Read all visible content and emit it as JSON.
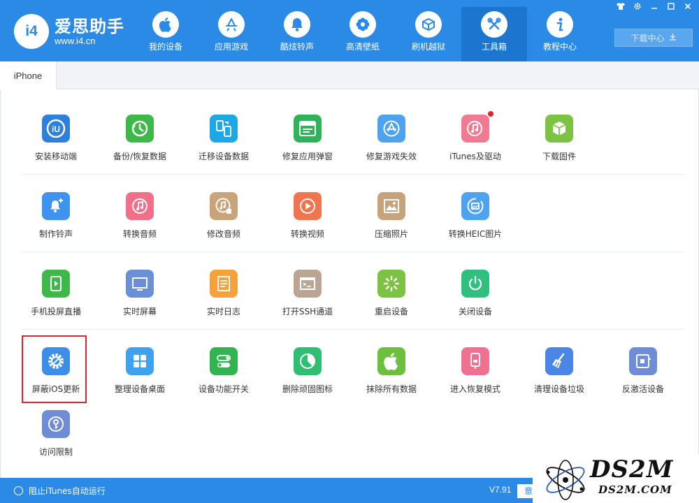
{
  "app": {
    "brand": "爱思助手",
    "url": "www.i4.cn",
    "logo_mark": "i4",
    "window_controls": [
      "shirt-icon",
      "gear-icon",
      "minimize-icon",
      "maximize-icon",
      "close-icon"
    ]
  },
  "nav": {
    "items": [
      {
        "label": "我的设备",
        "icon": "apple-icon"
      },
      {
        "label": "应用游戏",
        "icon": "app-store-icon"
      },
      {
        "label": "酷炫铃声",
        "icon": "bell-icon"
      },
      {
        "label": "高清壁纸",
        "icon": "flower-icon"
      },
      {
        "label": "刷机越狱",
        "icon": "box-icon"
      },
      {
        "label": "工具箱",
        "icon": "tools-icon",
        "active": true
      },
      {
        "label": "教程中心",
        "icon": "info-icon"
      }
    ],
    "download_label": "下载中心"
  },
  "tabs": [
    {
      "label": "iPhone",
      "active": true
    }
  ],
  "tools": {
    "row1": [
      {
        "label": "安装移动端",
        "color": "#2f7fdc"
      },
      {
        "label": "备份/恢复数据",
        "color": "#3fb84a"
      },
      {
        "label": "迁移设备数据",
        "color": "#1ca7e6"
      },
      {
        "label": "修复应用弹窗",
        "color": "#2fb35a"
      },
      {
        "label": "修复游戏失效",
        "color": "#4ea2ee"
      },
      {
        "label": "iTunes及驱动",
        "color": "#f07a92",
        "badge": true
      },
      {
        "label": "下载固件",
        "color": "#7cc243"
      }
    ],
    "row2": [
      {
        "label": "制作铃声",
        "color": "#3d93ee"
      },
      {
        "label": "转换音频",
        "color": "#f0708a"
      },
      {
        "label": "修改音频",
        "color": "#c9a47a"
      },
      {
        "label": "转换视频",
        "color": "#f0744e"
      },
      {
        "label": "压缩照片",
        "color": "#c7a37c"
      },
      {
        "label": "转换HEIC图片",
        "color": "#4ea2ee"
      }
    ],
    "row3": [
      {
        "label": "手机投屏直播",
        "color": "#3fb84a"
      },
      {
        "label": "实时屏幕",
        "color": "#6b8fd6"
      },
      {
        "label": "实时日志",
        "color": "#f5a13c"
      },
      {
        "label": "打开SSH通道",
        "color": "#b9a592"
      },
      {
        "label": "重启设备",
        "color": "#7cc243"
      },
      {
        "label": "关闭设备",
        "color": "#2fbf7e"
      }
    ],
    "row4": [
      {
        "label": "屏蔽iOS更新",
        "color": "#3d8ee8"
      },
      {
        "label": "整理设备桌面",
        "color": "#3fa2ee"
      },
      {
        "label": "设备功能开关",
        "color": "#32b550"
      },
      {
        "label": "删除顽固图标",
        "color": "#2fbf72"
      },
      {
        "label": "抹除所有数据",
        "color": "#6cc03e"
      },
      {
        "label": "进入恢复模式",
        "color": "#f07092"
      },
      {
        "label": "清理设备垃圾",
        "color": "#4a86e6"
      },
      {
        "label": "反激活设备",
        "color": "#6e8dd6"
      }
    ],
    "row5": [
      {
        "label": "访问限制",
        "color": "#6e8dd6"
      }
    ]
  },
  "status": {
    "itunes_label": "阻止iTunes自动运行",
    "version": "V7.91",
    "feedback_label": "意"
  },
  "watermark": {
    "big": "DS2M",
    "small": "DS2M.COM"
  }
}
